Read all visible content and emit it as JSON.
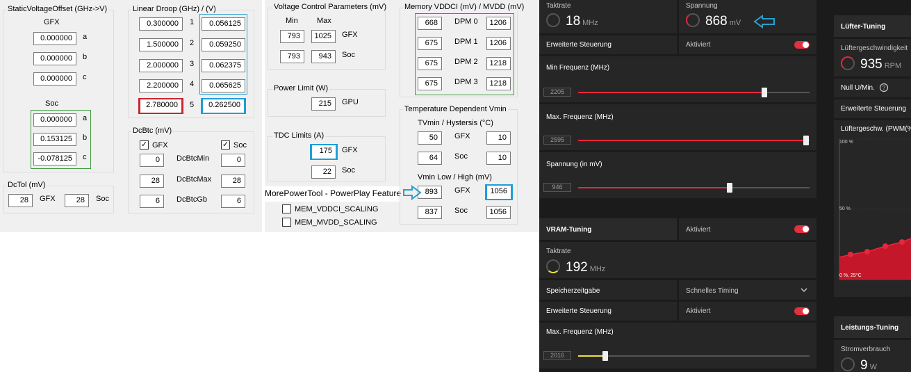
{
  "static_voltage": {
    "title": "StaticVoltageOffset (GHz->V)",
    "gfx_label": "GFX",
    "gfx": [
      {
        "v": "0.000000",
        "k": "a"
      },
      {
        "v": "0.000000",
        "k": "b"
      },
      {
        "v": "0.000000",
        "k": "c"
      }
    ],
    "soc_label": "Soc",
    "soc": [
      {
        "v": "0.000000",
        "k": "a"
      },
      {
        "v": "0.153125",
        "k": "b"
      },
      {
        "v": "-0.078125",
        "k": "c"
      }
    ]
  },
  "dctol": {
    "title": "DcTol (mV)",
    "gfx": "28",
    "gfx_label": "GFX",
    "soc": "28",
    "soc_label": "Soc"
  },
  "linear_droop": {
    "title": "Linear Droop (GHz) / (V)",
    "rows": [
      {
        "ghz": "0.300000",
        "n": "1",
        "v": "0.056125"
      },
      {
        "ghz": "1.500000",
        "n": "2",
        "v": "0.059250"
      },
      {
        "ghz": "2.000000",
        "n": "3",
        "v": "0.062375"
      },
      {
        "ghz": "2.200000",
        "n": "4",
        "v": "0.065625"
      },
      {
        "ghz": "2.780000",
        "n": "5",
        "v": "0.262500"
      }
    ]
  },
  "dcbtc": {
    "title": "DcBtc (mV)",
    "gfx_label": "GFX",
    "soc_label": "Soc",
    "rows": [
      {
        "gfx": "0",
        "label": "DcBtcMin",
        "soc": "0"
      },
      {
        "gfx": "28",
        "label": "DcBtcMax",
        "soc": "28"
      },
      {
        "gfx": "6",
        "label": "DcBtcGb",
        "soc": "6"
      }
    ]
  },
  "voltage_control": {
    "title": "Voltage Control Parameters (mV)",
    "min_label": "Min",
    "max_label": "Max",
    "rows": [
      {
        "min": "793",
        "max": "1025",
        "label": "GFX"
      },
      {
        "min": "793",
        "max": "943",
        "label": "Soc"
      }
    ]
  },
  "power_limit": {
    "title": "Power Limit (W)",
    "value": "215",
    "label": "GPU"
  },
  "tdc": {
    "title": "TDC Limits (A)",
    "rows": [
      {
        "v": "175",
        "label": "GFX"
      },
      {
        "v": "22",
        "label": "Soc"
      }
    ]
  },
  "callout": {
    "text": "MorePowerTool - PowerPlay Feature"
  },
  "features": [
    {
      "label": "MEM_VDDCI_SCALING"
    },
    {
      "label": "MEM_MVDD_SCALING"
    }
  ],
  "memory": {
    "title": "Memory VDDCI (mV) / MVDD (mV)",
    "rows": [
      {
        "a": "668",
        "dpm": "DPM 0",
        "b": "1206"
      },
      {
        "a": "675",
        "dpm": "DPM 1",
        "b": "1206"
      },
      {
        "a": "675",
        "dpm": "DPM 2",
        "b": "1218"
      },
      {
        "a": "675",
        "dpm": "DPM 3",
        "b": "1218"
      }
    ]
  },
  "temp_vmin": {
    "title": "Temperature Dependent Vmin",
    "sub1": "TVmin / Hystersis (°C)",
    "rows1": [
      {
        "a": "50",
        "label": "GFX",
        "b": "10"
      },
      {
        "a": "64",
        "label": "Soc",
        "b": "10"
      }
    ],
    "sub2": "Vmin Low / High (mV)",
    "rows2": [
      {
        "a": "893",
        "label": "GFX",
        "b": "1056"
      },
      {
        "a": "837",
        "label": "Soc",
        "b": "1056"
      }
    ]
  },
  "amd": {
    "taktrate_label": "Taktrate",
    "taktrate": "18",
    "taktrate_unit": "MHz",
    "spannung_label": "Spannung",
    "spannung": "868",
    "spannung_unit": "mV",
    "erweiterte": "Erweiterte Steuerung",
    "aktiviert": "Aktiviert",
    "min_freq_label": "Min Frequenz (MHz)",
    "min_freq": "2205",
    "max_freq_label": "Max. Frequenz (MHz)",
    "max_freq": "2595",
    "spannung_mv_label": "Spannung (in mV)",
    "spannung_mv": "946",
    "vram_title": "VRAM-Tuning",
    "vram_aktiviert": "Aktiviert",
    "vram_takt_label": "Taktrate",
    "vram_takt": "192",
    "vram_takt_unit": "MHz",
    "speicher_label": "Speicherzeitgabe",
    "speicher_value": "Schnelles Timing",
    "vram_erweiterte": "Erweiterte Steuerung",
    "vram_erweiterte_value": "Aktiviert",
    "vram_max_label": "Max. Frequenz (MHz)",
    "vram_max": "2016",
    "luefter_title": "Lüfter-Tuning",
    "luefter_speed_label": "Lüftergeschwindigkeit",
    "luefter_speed": "935",
    "luefter_unit": "RPM",
    "null_label": "Null U/Min.",
    "luefter_erweiterte": "Erweiterte Steuerung",
    "luefter_pwm_label": "Lüftergeschw. (PWM(%))",
    "chart_100": "100 %",
    "chart_50": "50 %",
    "chart_0": "0 %, 25°C",
    "leistung_title": "Leistungs-Tuning",
    "strom_label": "Stromverbrauch",
    "strom": "9",
    "strom_unit": "W",
    "colors": {
      "accent": "#e8273a",
      "vram_slider": "#f0e040",
      "arrow": "#2a9fd0"
    }
  }
}
